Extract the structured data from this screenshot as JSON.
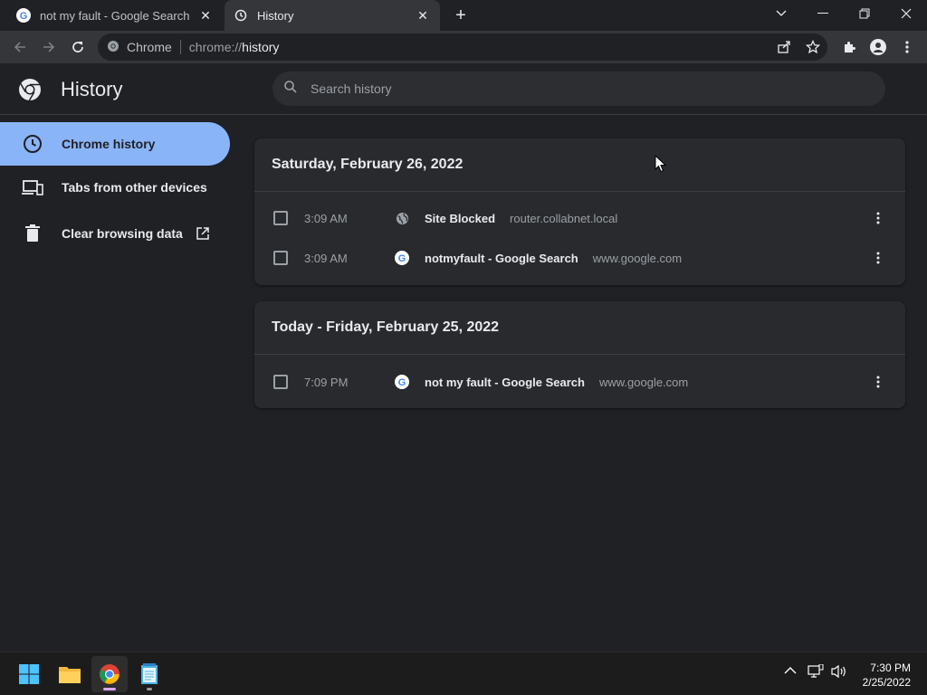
{
  "tabs": [
    {
      "title": "not my fault - Google Search",
      "favicon": "google-icon",
      "active": false
    },
    {
      "title": "History",
      "favicon": "history-icon",
      "active": true
    }
  ],
  "toolbar": {
    "chip": "Chrome",
    "url_scheme": "chrome://",
    "url_path": "history"
  },
  "app": {
    "title": "History",
    "search_placeholder": "Search history"
  },
  "sidebar": {
    "items": [
      {
        "label": "Chrome history",
        "icon": "clock-icon",
        "selected": true
      },
      {
        "label": "Tabs from other devices",
        "icon": "devices-icon",
        "selected": false
      },
      {
        "label": "Clear browsing data",
        "icon": "trash-icon",
        "selected": false
      }
    ]
  },
  "history": [
    {
      "date": "Saturday, February 26, 2022",
      "entries": [
        {
          "time": "3:09 AM",
          "title": "Site Blocked",
          "domain": "router.collabnet.local",
          "favicon": "globe-icon"
        },
        {
          "time": "3:09 AM",
          "title": "notmyfault - Google Search",
          "domain": "www.google.com",
          "favicon": "google-icon"
        }
      ]
    },
    {
      "date": "Today - Friday, February 25, 2022",
      "entries": [
        {
          "time": "7:09 PM",
          "title": "not my fault - Google Search",
          "domain": "www.google.com",
          "favicon": "google-icon"
        }
      ]
    }
  ],
  "taskbar": {
    "time": "7:30 PM",
    "date": "2/25/2022"
  },
  "colors": {
    "accent": "#8ab4f8",
    "background": "#202124",
    "card": "#292a2d"
  }
}
